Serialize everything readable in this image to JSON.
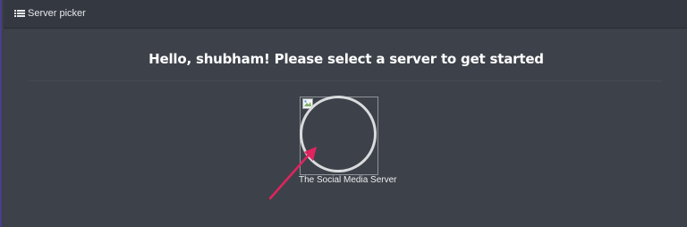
{
  "header": {
    "title": "Server picker",
    "icon": "list-icon"
  },
  "main": {
    "greeting": "Hello, shubham! Please select a server to get started",
    "servers": [
      {
        "name": "The Social Media Server",
        "image": "broken-image-icon"
      }
    ]
  },
  "colors": {
    "background": "#3d424a",
    "header": "#343941",
    "annotation_arrow": "#e0245e",
    "ring": "#d9dbdd"
  }
}
